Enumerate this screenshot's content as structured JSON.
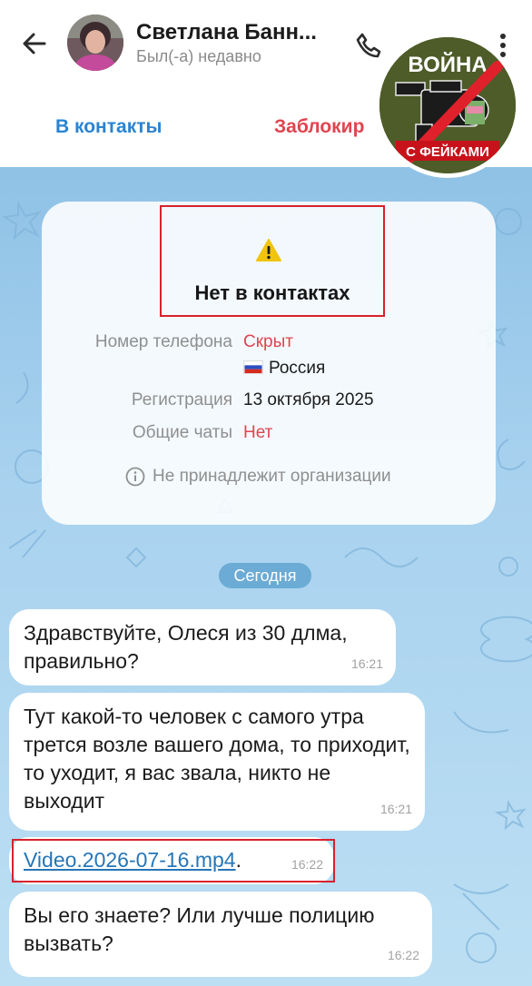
{
  "header": {
    "name": "Светлана Банн...",
    "status": "Был(-а) недавно"
  },
  "actions": {
    "add_contact": "В контакты",
    "block": "Заблокир"
  },
  "info_card": {
    "title": "Нет в контактах",
    "rows": [
      {
        "label": "Номер телефона",
        "value": "Скрыт"
      },
      {
        "label": "",
        "value": "Россия"
      },
      {
        "label": "Регистрация",
        "value": "13 октября 2025"
      },
      {
        "label": "Общие чаты",
        "value": "Нет"
      }
    ],
    "org_note": "Не принадлежит организации"
  },
  "date_divider": "Сегодня",
  "messages": [
    {
      "text": "Здравствуйте, Олеся из 30 длма, правильно?",
      "time": "16:21"
    },
    {
      "text": "Тут какой-то человек с самого утра трется возле вашего дома, то приходит, то уходит, я вас звала, никто не выходит",
      "time": "16:21"
    },
    {
      "link": "Video.2026-07-16.mp4",
      "suffix": ".",
      "time": "16:22"
    },
    {
      "text": "Вы его знаете? Или лучше полицию вызвать?",
      "time": "16:22"
    }
  ],
  "watermark": {
    "top_text": "ВОЙНА",
    "bottom_text": "С ФЕЙКАМИ"
  },
  "colors": {
    "accent_blue": "#2a84d1",
    "danger_red": "#e0444f",
    "highlight_frame": "#d8212c",
    "chat_bg": "#9fcbeb"
  },
  "icons": [
    "back-arrow-icon",
    "phone-icon",
    "more-vert-icon",
    "warning-icon",
    "info-icon",
    "russia-flag-icon"
  ]
}
